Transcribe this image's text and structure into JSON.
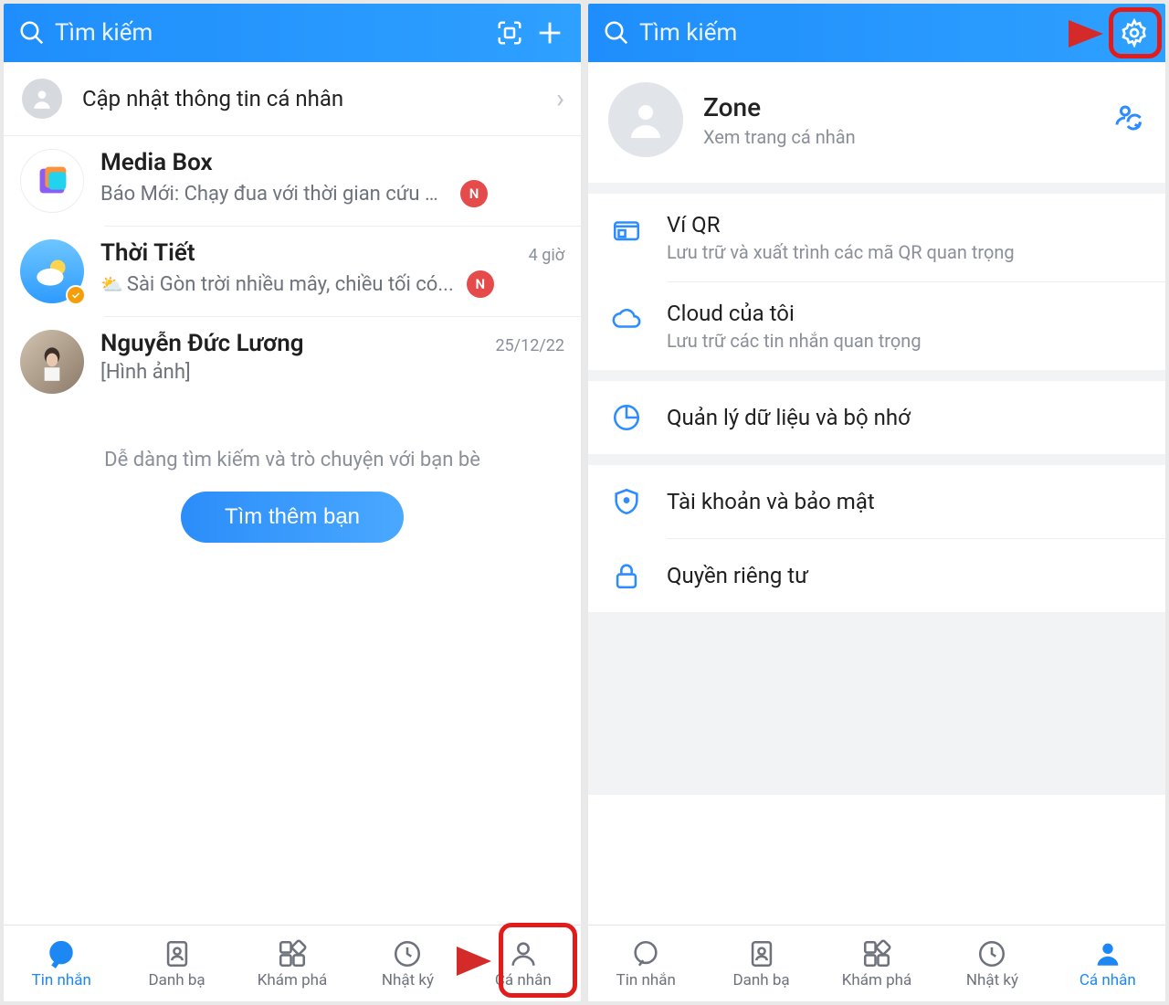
{
  "left": {
    "header": {
      "placeholder": "Tìm kiếm"
    },
    "update_row": "Cập nhật thông tin cá nhân",
    "chats": [
      {
        "name": "Media Box",
        "preview": "Báo Mới: Chạy đua với thời gian cứu bé...",
        "time": "",
        "badge": "N"
      },
      {
        "name": "Thời Tiết",
        "preview": "Sài Gòn trời nhiều mây, chiều tối có...",
        "time": "4 giờ",
        "badge": "N"
      },
      {
        "name": "Nguyễn Đức Lương",
        "preview": "[Hình ảnh]",
        "time": "25/12/22",
        "badge": ""
      }
    ],
    "hint": "Dễ dàng tìm kiếm và trò chuyện với bạn bè",
    "find_btn": "Tìm thêm bạn",
    "tabs": [
      "Tin nhắn",
      "Danh bạ",
      "Khám phá",
      "Nhật ký",
      "Cá nhân"
    ]
  },
  "right": {
    "header": {
      "placeholder": "Tìm kiếm"
    },
    "profile": {
      "name": "Zone",
      "sub": "Xem trang cá nhân"
    },
    "menu": {
      "qr": {
        "title": "Ví QR",
        "sub": "Lưu trữ và xuất trình các mã QR quan trọng"
      },
      "cloud": {
        "title": "Cloud của tôi",
        "sub": "Lưu trữ các tin nhắn quan trọng"
      },
      "data": {
        "title": "Quản lý dữ liệu và bộ nhớ"
      },
      "account": {
        "title": "Tài khoản và bảo mật"
      },
      "privacy": {
        "title": "Quyền riêng tư"
      }
    },
    "tabs": [
      "Tin nhắn",
      "Danh bạ",
      "Khám phá",
      "Nhật ký",
      "Cá nhân"
    ]
  }
}
